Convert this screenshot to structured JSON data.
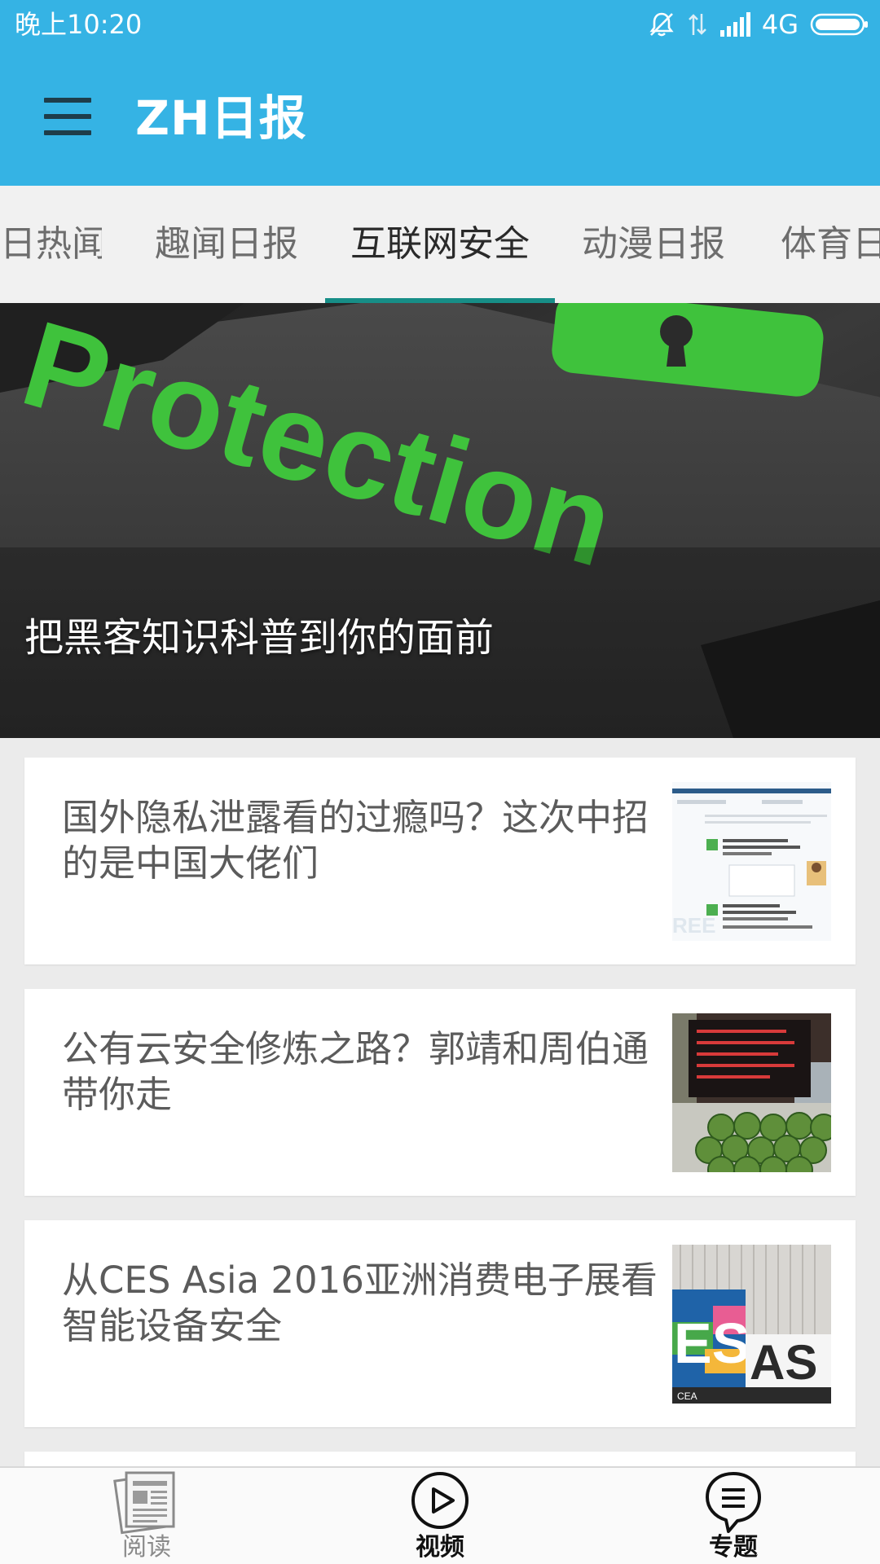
{
  "status_bar": {
    "time": "晚上10:20",
    "network": "4G",
    "icons": [
      "mute-icon",
      "data-transfer-icon",
      "signal-icon",
      "battery-icon"
    ]
  },
  "toolbar": {
    "title": "ZH日报",
    "menu_icon": "hamburger-menu-icon"
  },
  "tabs": [
    {
      "label": "日热闻"
    },
    {
      "label": "趣闻日报"
    },
    {
      "label": "互联网安全",
      "active": true
    },
    {
      "label": "动漫日报"
    },
    {
      "label": "体育日"
    }
  ],
  "banner": {
    "caption": "把黑客知识科普到你的面前",
    "key_text": "Protection"
  },
  "articles": [
    {
      "title": "国外隐私泄露看的过瘾吗？这次中招的是中国大佬们",
      "thumbnail": "screenshot-thumbnail"
    },
    {
      "title": "公有云安全修炼之路？郭靖和周伯通带你走",
      "thumbnail": "watermelon-stall-thumbnail"
    },
    {
      "title": "从CES Asia 2016亚洲消费电子展看智能设备安全",
      "thumbnail": "ces-asia-sign-thumbnail"
    }
  ],
  "bottom_nav": [
    {
      "label": "阅读",
      "icon": "newspaper-icon",
      "active": false
    },
    {
      "label": "视频",
      "icon": "play-circle-icon",
      "active": true
    },
    {
      "label": "专题",
      "icon": "chat-list-icon",
      "active": true
    }
  ],
  "colors": {
    "primary": "#35b3e4",
    "tab_indicator": "#178e87",
    "banner_green": "#3fc23c"
  }
}
